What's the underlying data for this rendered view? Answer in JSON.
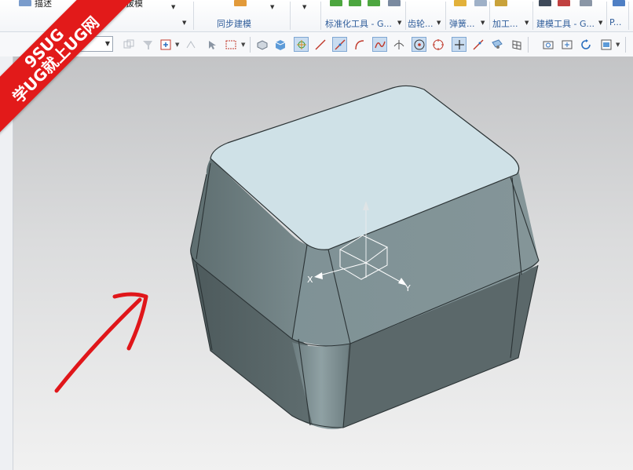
{
  "ribbon": {
    "items": [
      {
        "label": "描述",
        "name": "ribbon-item-describe"
      },
      {
        "label": "拔模",
        "name": "ribbon-item-draft"
      }
    ],
    "groups": [
      {
        "label": "同步建模",
        "name": "ribbon-group-sync-modeling"
      },
      {
        "label": "标准化工具 - G...",
        "name": "ribbon-group-standard-tools"
      },
      {
        "label": "齿轮...",
        "name": "ribbon-group-gear"
      },
      {
        "label": "弹簧...",
        "name": "ribbon-group-spring"
      },
      {
        "label": "加工...",
        "name": "ribbon-group-machining"
      },
      {
        "label": "建模工具 - G...",
        "name": "ribbon-group-modeling-tools"
      },
      {
        "label": "P...",
        "name": "ribbon-group-p"
      }
    ],
    "caret": "▼"
  },
  "toolbar": {
    "filter_value": "",
    "caret": "▼"
  },
  "watermark": {
    "line1": "9SUG",
    "line2": "学UG就上UG网"
  },
  "axes": {
    "x_label": "X",
    "y_label": "Y",
    "z_label": ""
  },
  "colors": {
    "model_top": "#cce0e6",
    "model_side": "#6f8082",
    "annotation_arrow": "#e0161a",
    "banner": "#e21a1a",
    "ribbon_text": "#2f5d9a"
  }
}
